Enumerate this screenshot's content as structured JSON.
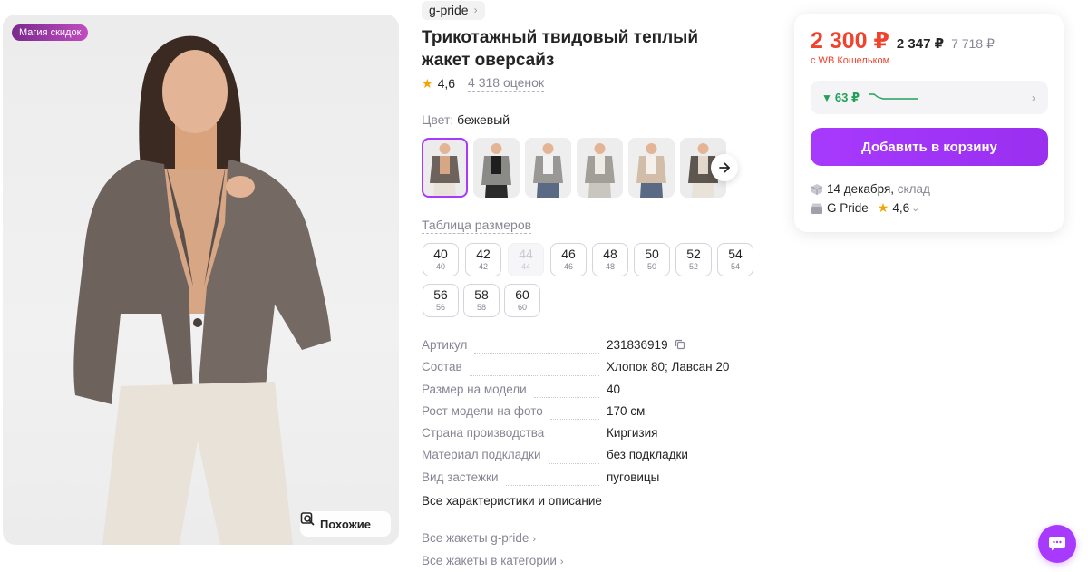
{
  "photo": {
    "badge": "Магия скидок",
    "similar_label": "Похожие"
  },
  "product": {
    "brand": "g-pride",
    "title": "Трикотажный твидовый теплый жакет оверсайз",
    "rating": "4,6",
    "reviews": "4 318 оценок",
    "color_label": "Цвет:",
    "color_value": "бежевый"
  },
  "thumbnails": [
    {
      "name": "thumb-1",
      "selected": true
    },
    {
      "name": "thumb-2",
      "selected": false
    },
    {
      "name": "thumb-3",
      "selected": false
    },
    {
      "name": "thumb-4",
      "selected": false
    },
    {
      "name": "thumb-5",
      "selected": false
    },
    {
      "name": "thumb-6",
      "selected": false
    }
  ],
  "size_table_link": "Таблица размеров",
  "sizes": [
    {
      "ru": "40",
      "eu": "40",
      "available": true
    },
    {
      "ru": "42",
      "eu": "42",
      "available": true
    },
    {
      "ru": "44",
      "eu": "44",
      "available": false
    },
    {
      "ru": "46",
      "eu": "46",
      "available": true
    },
    {
      "ru": "48",
      "eu": "48",
      "available": true
    },
    {
      "ru": "50",
      "eu": "50",
      "available": true
    },
    {
      "ru": "52",
      "eu": "52",
      "available": true
    },
    {
      "ru": "54",
      "eu": "54",
      "available": true
    },
    {
      "ru": "56",
      "eu": "56",
      "available": true
    },
    {
      "ru": "58",
      "eu": "58",
      "available": true
    },
    {
      "ru": "60",
      "eu": "60",
      "available": true
    }
  ],
  "specs": [
    {
      "key": "Артикул",
      "value": "231836919"
    },
    {
      "key": "Состав",
      "value": "Хлопок 80; Лавсан 20"
    },
    {
      "key": "Размер на модели",
      "value": "40"
    },
    {
      "key": "Рост модели на фото",
      "value": "170 см"
    },
    {
      "key": "Страна производства",
      "value": "Киргизия"
    },
    {
      "key": "Материал подкладки",
      "value": "без подкладки"
    },
    {
      "key": "Вид застежки",
      "value": "пуговицы"
    }
  ],
  "all_specs_link": "Все характеристики и описание",
  "category_links": [
    "Все жакеты g-pride",
    "Все жакеты в категории"
  ],
  "price": {
    "main": "2 300 ₽",
    "second": "2 347 ₽",
    "old": "7 718 ₽",
    "wallet_note": "с WB Кошельком",
    "history_delta": "63 ₽",
    "add_to_cart": "Добавить в корзину",
    "delivery_date": "14 декабря,",
    "delivery_from": "склад",
    "seller": "G Pride",
    "seller_rating": "4,6"
  },
  "colors": {
    "accent": "#a73afd",
    "price_red": "#f0432e",
    "green": "#22a05a"
  }
}
